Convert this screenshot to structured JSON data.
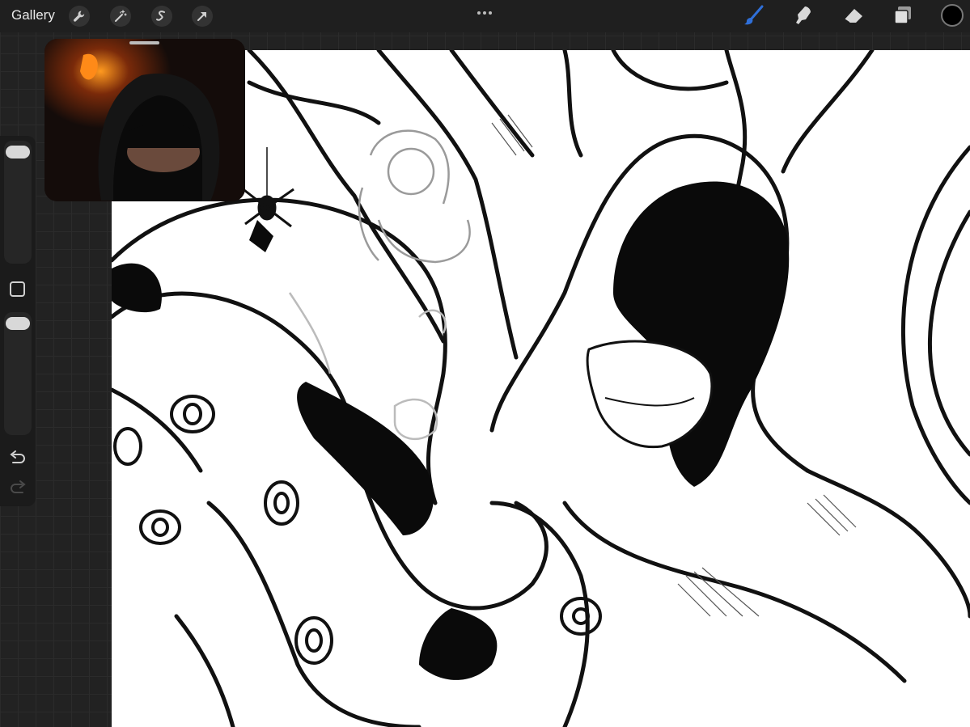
{
  "topbar": {
    "gallery_label": "Gallery",
    "left_tools": [
      "wrench-icon",
      "magic-wand-icon",
      "selection-icon",
      "transform-arrow-icon"
    ],
    "right_tools": [
      "brush-icon",
      "smudge-icon",
      "eraser-icon",
      "layers-icon"
    ],
    "current_color": "#000000",
    "brush_accent": "#2f6fd8"
  },
  "sidebar": {
    "tools": [
      "brush-size-slider",
      "modify-button",
      "opacity-slider",
      "undo-icon",
      "redo-icon"
    ]
  },
  "reference_window": {
    "content": "reference-camera-image"
  }
}
